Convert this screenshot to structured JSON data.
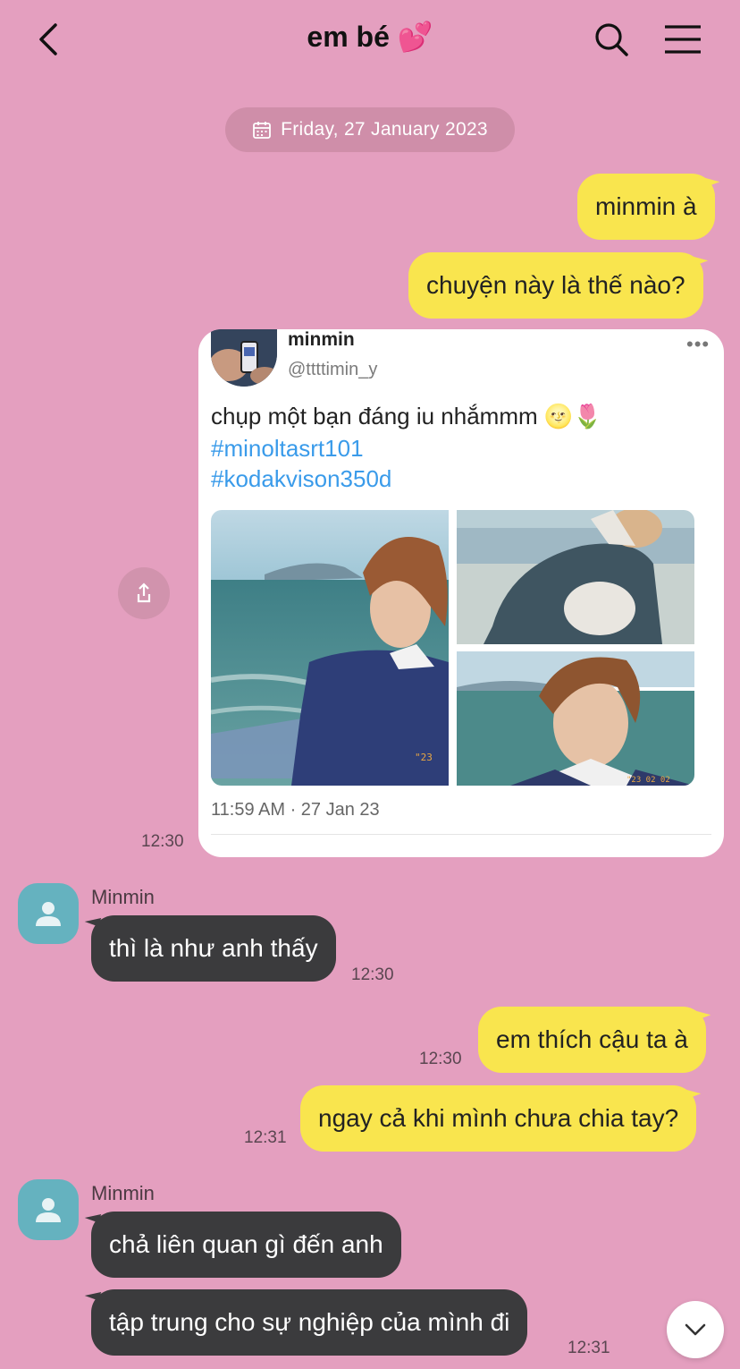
{
  "header": {
    "title": "em bé 💕",
    "back_icon": "chevron-left-icon",
    "search_icon": "search-icon",
    "menu_icon": "hamburger-menu-icon"
  },
  "date_divider": {
    "label": "Friday, 27 January 2023",
    "icon": "calendar-icon"
  },
  "colors": {
    "background": "#e49fbf",
    "my_bubble": "#f9e54e",
    "their_bubble": "#3b3b3d",
    "avatar": "#65b2bf",
    "hashtag": "#3a9bea"
  },
  "messages": [
    {
      "from": "me",
      "text": "minmin à"
    },
    {
      "from": "me",
      "text": "chuyện này là thế nào?"
    },
    {
      "from": "me",
      "type": "shared_tweet",
      "time": "12:30"
    },
    {
      "from": "them",
      "sender": "Minmin",
      "text": "thì là như anh thấy",
      "time": "12:30"
    },
    {
      "from": "me",
      "text": "em thích cậu ta à",
      "time": "12:30"
    },
    {
      "from": "me",
      "text": "ngay cả khi mình chưa chia tay?",
      "time": "12:31"
    },
    {
      "from": "them",
      "sender": "Minmin",
      "text": "chả liên quan gì đến anh"
    },
    {
      "from": "them",
      "text": "tập trung cho sự nghiệp của mình đi",
      "time": "12:31"
    }
  ],
  "tweet": {
    "name": "minmin",
    "handle": "@ttttimin_y",
    "text": "chụp một bạn đáng iu nhắmmm 🌝🌷",
    "hashtags": [
      "#minoltasrt101",
      "#kodakvison350d"
    ],
    "meta": "11:59 AM · 27 Jan 23",
    "more_icon": "more-dots-icon",
    "photo_stamps": [
      "\"23",
      "\"23 02 02"
    ]
  },
  "share_icon": "share-icon",
  "scroll_down_icon": "chevron-down-icon"
}
